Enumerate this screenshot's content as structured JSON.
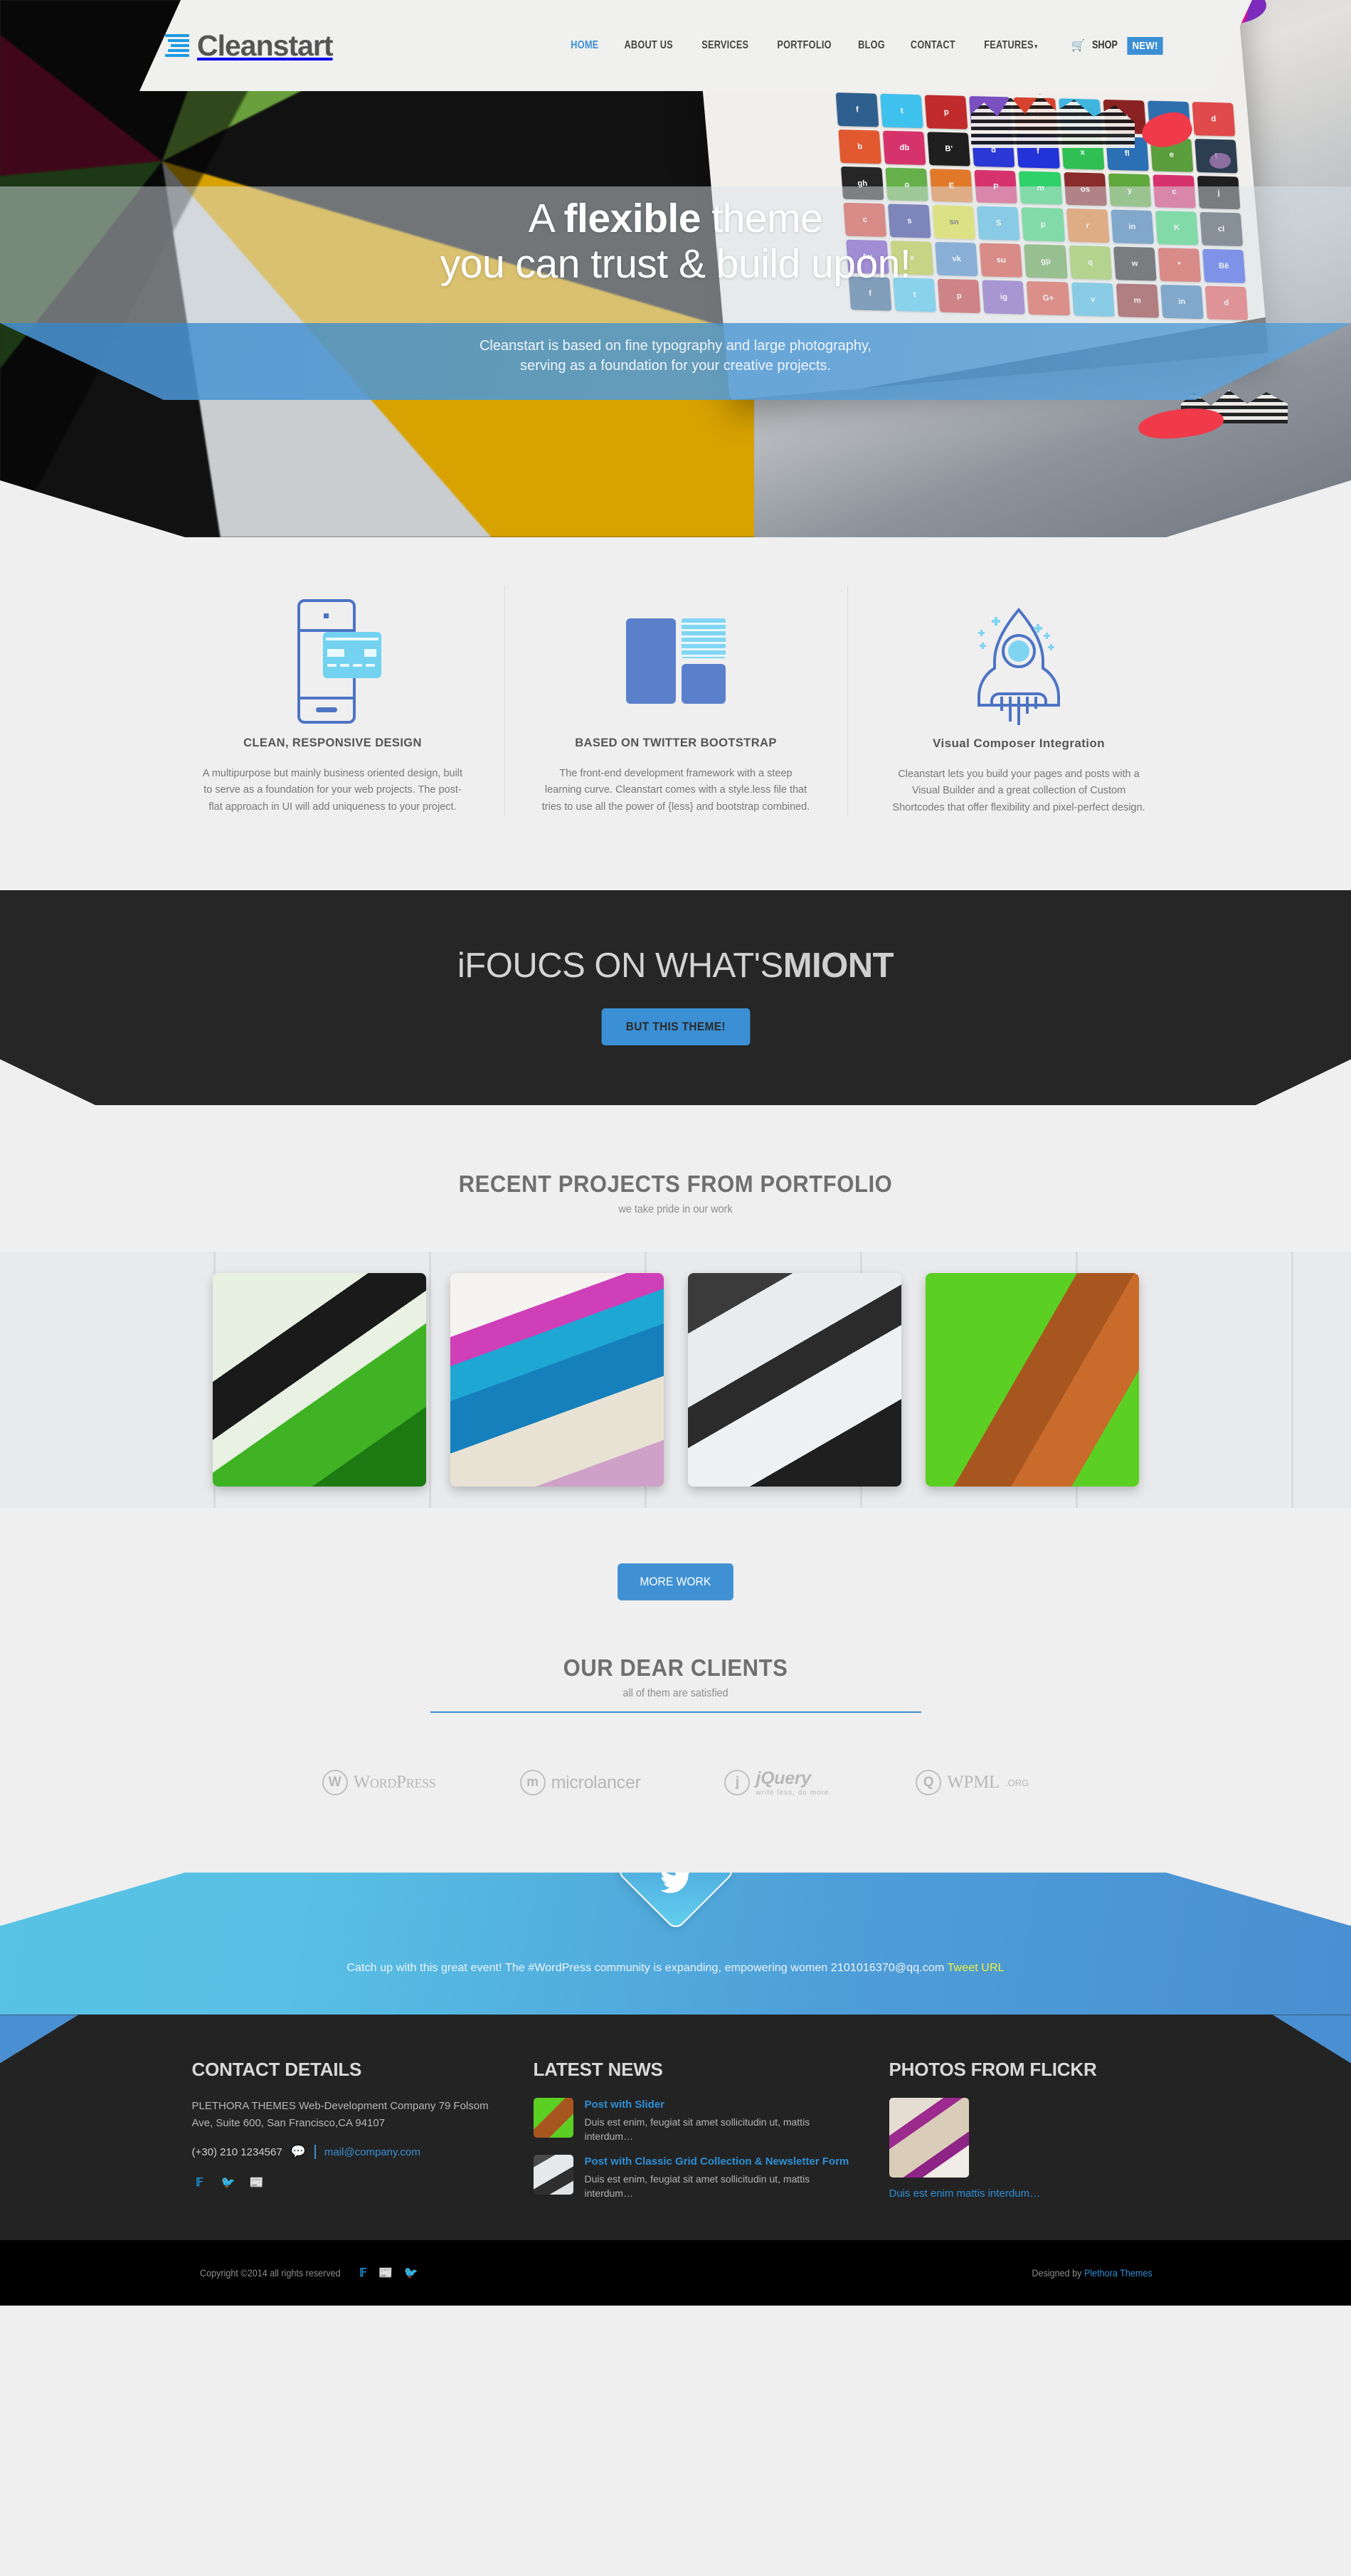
{
  "header": {
    "logo_text": "Cleanstart",
    "nav": [
      {
        "label": "HOME",
        "active": true
      },
      {
        "label": "ABOUT US",
        "active": false
      },
      {
        "label": "SERVICES",
        "active": false
      },
      {
        "label": "PORTFOLIO",
        "active": false
      },
      {
        "label": "BLOG",
        "active": false
      },
      {
        "label": "CONTACT",
        "active": false
      },
      {
        "label": "FEATURES",
        "active": false,
        "caret": "▾"
      }
    ],
    "shop_label": "SHOP",
    "badge_new": "NEW!",
    "cart_icon": "cart-icon"
  },
  "hero": {
    "title_part1": "A ",
    "title_bold": "flexible",
    "title_part2": " theme",
    "title_line2": "you can trust & build upon!",
    "sub_line1": "Cleanstart is based on fine typography and large photography,",
    "sub_line2": "serving as a foundation for your creative projects."
  },
  "features": [
    {
      "icon": "mobile-responsive-icon",
      "title": "CLEAN, RESPONSIVE DESIGN",
      "body": "A multipurpose but mainly business oriented design, built to serve as a foundation for your web projects. The post-flat approach in UI will add uniqueness to your project."
    },
    {
      "icon": "bootstrap-blocks-icon",
      "title": "BASED ON TWITTER BOOTSTRAP",
      "body": "The front-end development framework with a steep learning curve. Cleanstart comes with a style.less file that tries to use all the power of {less} and bootstrap combined."
    },
    {
      "icon": "rocket-icon",
      "title": "Visual Composer Integration",
      "body": "Cleanstart lets you build your pages and posts with a Visual Builder and a great collection of Custom Shortcodes that offer flexibility and pixel-perfect design."
    }
  ],
  "cta": {
    "title_light": "iFOUCS ON WHAT'S",
    "title_bold": "MIONT",
    "button": "BUT THIS THEME!"
  },
  "portfolio": {
    "title": "RECENT PROJECTS FROM PORTFOLIO",
    "subtitle": "we take pride in our work",
    "items": [
      {
        "name": "project-thumb-1"
      },
      {
        "name": "project-thumb-2"
      },
      {
        "name": "project-thumb-3"
      },
      {
        "name": "project-thumb-4"
      }
    ],
    "more_button": "MORE WORK"
  },
  "clients": {
    "title": "OUR DEAR CLIENTS",
    "subtitle": "all of them are satisfied",
    "logos": [
      {
        "mark": "W",
        "name": "WordPress",
        "sub": ""
      },
      {
        "mark": "m",
        "name": "microlancer",
        "sub": ""
      },
      {
        "mark": "j",
        "name": "jQuery",
        "sub": "write less, do more."
      },
      {
        "mark": "Q",
        "name": "WPML",
        "sub": ".ORG"
      }
    ]
  },
  "twitter": {
    "icon": "twitter-bird-icon",
    "text": "Catch up with this great event! The #WordPress community is expanding, empowering women 2101016370@qq.com ",
    "link_label": "Tweet URL"
  },
  "footer": {
    "contact": {
      "heading": "CONTACT DETAILS",
      "address": "PLETHORA THEMES Web-Development Company 79 Folsom Ave, Suite 600, San Francisco,CA 94107",
      "phone": "(+30) 210 1234567",
      "email": "mail@company.com",
      "socials": [
        "facebook-icon",
        "twitter-icon",
        "rss-icon"
      ]
    },
    "news": {
      "heading": "LATEST NEWS",
      "items": [
        {
          "title": "Post with Slider",
          "excerpt": "Duis est enim, feugiat sit amet sollicitudin ut, mattis interdum…"
        },
        {
          "title": "Post with Classic Grid Collection & Newsletter Form",
          "excerpt": "Duis est enim, feugiat sit amet sollicitudin ut, mattis interdum…"
        }
      ]
    },
    "flickr": {
      "heading": "PHOTOS FROM FLICKR",
      "caption": "Duis est enim mattis interdum…"
    }
  },
  "bottombar": {
    "copyright": "Copyright ©2014 all rights reserved",
    "icons": [
      "facebook-icon",
      "rss-icon",
      "twitter-icon"
    ],
    "designed_prefix": "Designed by ",
    "designed_link": "Plethora Themes"
  },
  "colors": {
    "accent_blue": "#3b8fd4",
    "dark": "#262626",
    "page_bg": "#efefef",
    "link_yellow": "#f2f23a"
  }
}
